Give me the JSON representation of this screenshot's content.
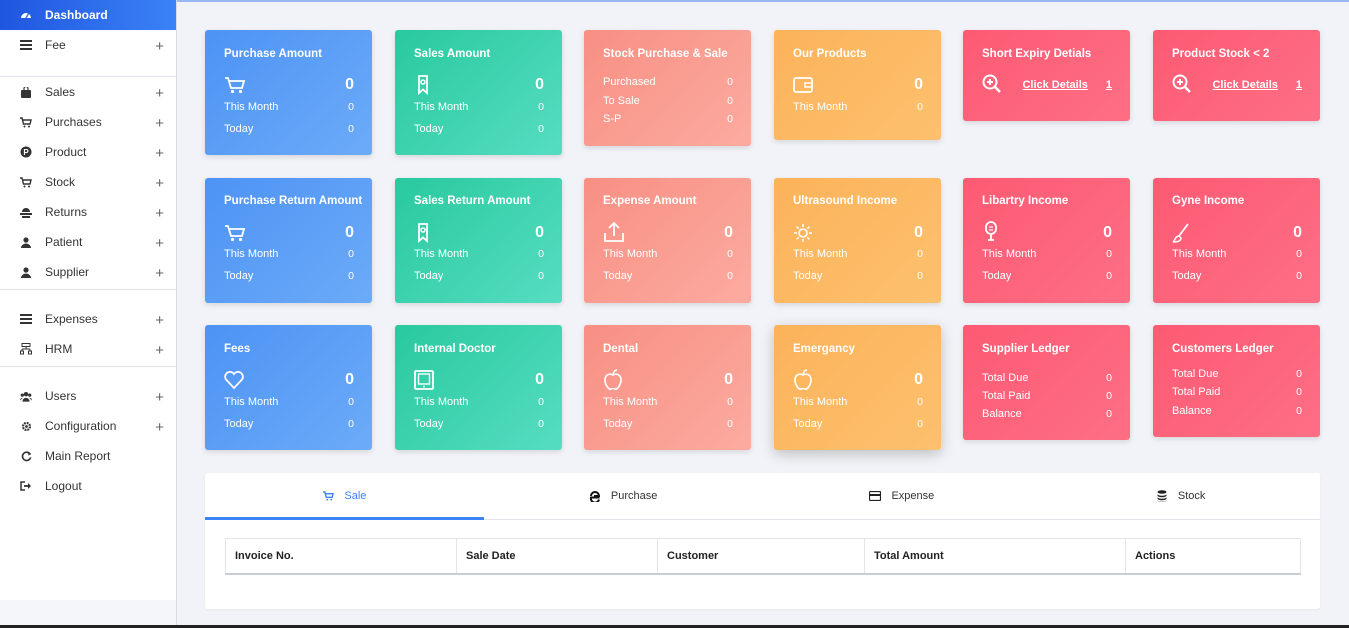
{
  "sidebar": {
    "items": [
      {
        "label": "Dashboard",
        "icon": "dashboard-icon",
        "plus": false
      },
      {
        "label": "Fee",
        "icon": "list-icon",
        "plus": true
      },
      {
        "label": "Sales",
        "icon": "bag-icon",
        "plus": true
      },
      {
        "label": "Purchases",
        "icon": "cart-icon",
        "plus": true
      },
      {
        "label": "Product",
        "icon": "product-icon",
        "plus": true
      },
      {
        "label": "Stock",
        "icon": "stock-cart-icon",
        "plus": true
      },
      {
        "label": "Returns",
        "icon": "returns-icon",
        "plus": true
      },
      {
        "label": "Patient",
        "icon": "user-icon",
        "plus": true
      },
      {
        "label": "Supplier",
        "icon": "user-icon",
        "plus": true
      },
      {
        "label": "Expenses",
        "icon": "list-icon",
        "plus": true
      },
      {
        "label": "HRM",
        "icon": "hrm-icon",
        "plus": true
      },
      {
        "label": "Users",
        "icon": "users-icon",
        "plus": true
      },
      {
        "label": "Configuration",
        "icon": "gear-icon",
        "plus": true
      },
      {
        "label": "Main Report",
        "icon": "refresh-icon",
        "plus": false
      },
      {
        "label": "Logout",
        "icon": "logout-icon",
        "plus": false
      }
    ],
    "plus_symbol": "+"
  },
  "cards": {
    "purchase_amount": {
      "title": "Purchase Amount",
      "big": "0",
      "r1": "This Month",
      "r1v": "0",
      "r2": "Today",
      "r2v": "0"
    },
    "sales_amount": {
      "title": "Sales Amount",
      "big": "0",
      "r1": "This Month",
      "r1v": "0",
      "r2": "Today",
      "r2v": "0"
    },
    "stock_purchase_sale": {
      "title": "Stock Purchase & Sale",
      "r1": "Purchased",
      "r1v": "0",
      "r2": "To Sale",
      "r2v": "0",
      "r3": "S-P",
      "r3v": "0"
    },
    "our_products": {
      "title": "Our Products",
      "big": "0",
      "r1": "This Month",
      "r1v": "0"
    },
    "short_expiry": {
      "title": "Short Expiry Detials",
      "link": "Click Details",
      "count": "1"
    },
    "product_stock": {
      "title": "Product Stock < 2",
      "link": "Click Details",
      "count": "1"
    },
    "purchase_return": {
      "title": "Purchase Return Amount",
      "big": "0",
      "r1": "This Month",
      "r1v": "0",
      "r2": "Today",
      "r2v": "0"
    },
    "sales_return": {
      "title": "Sales Return Amount",
      "big": "0",
      "r1": "This Month",
      "r1v": "0",
      "r2": "Today",
      "r2v": "0"
    },
    "expense_amount": {
      "title": "Expense Amount",
      "big": "0",
      "r1": "This Month",
      "r1v": "0",
      "r2": "Today",
      "r2v": "0"
    },
    "ultrasound_income": {
      "title": "Ultrasound Income",
      "big": "0",
      "r1": "This Month",
      "r1v": "0",
      "r2": "Today",
      "r2v": "0"
    },
    "libartry_income": {
      "title": "Libartry Income",
      "big": "0",
      "r1": "This Month",
      "r1v": "0",
      "r2": "Today",
      "r2v": "0"
    },
    "gyne_income": {
      "title": "Gyne Income",
      "big": "0",
      "r1": "This Month",
      "r1v": "0",
      "r2": "Today",
      "r2v": "0"
    },
    "fees": {
      "title": "Fees",
      "big": "0",
      "r1": "This Month",
      "r1v": "0",
      "r2": "Today",
      "r2v": "0"
    },
    "internal_doctor": {
      "title": "Internal Doctor",
      "big": "0",
      "r1": "This Month",
      "r1v": "0",
      "r2": "Today",
      "r2v": "0"
    },
    "dental": {
      "title": "Dental",
      "big": "0",
      "r1": "This Month",
      "r1v": "0",
      "r2": "Today",
      "r2v": "0"
    },
    "emergancy": {
      "title": "Emergancy",
      "big": "0",
      "r1": "This Month",
      "r1v": "0",
      "r2": "Today",
      "r2v": "0"
    },
    "supplier_ledger": {
      "title": "Supplier Ledger",
      "r1": "Total Due",
      "r1v": "0",
      "r2": "Total Paid",
      "r2v": "0",
      "r3": "Balance",
      "r3v": "0"
    },
    "customers_ledger": {
      "title": "Customers Ledger",
      "r1": "Total Due",
      "r1v": "0",
      "r2": "Total Paid",
      "r2v": "0",
      "r3": "Balance",
      "r3v": "0"
    }
  },
  "tabs": [
    {
      "label": "Sale",
      "icon": "cart-icon"
    },
    {
      "label": "Purchase",
      "icon": "edge-e-icon"
    },
    {
      "label": "Expense",
      "icon": "credit-card-icon"
    },
    {
      "label": "Stock",
      "icon": "database-icon"
    }
  ],
  "table": {
    "headers": [
      "Invoice No.",
      "Sale Date",
      "Customer",
      "Total Amount",
      "Actions"
    ]
  },
  "colors": {
    "blue": "#4d93f5",
    "green": "#29c99e",
    "salmon": "#f88f83",
    "orange": "#fcb35a",
    "red": "#fd5a73",
    "accent": "#3b82f6"
  }
}
